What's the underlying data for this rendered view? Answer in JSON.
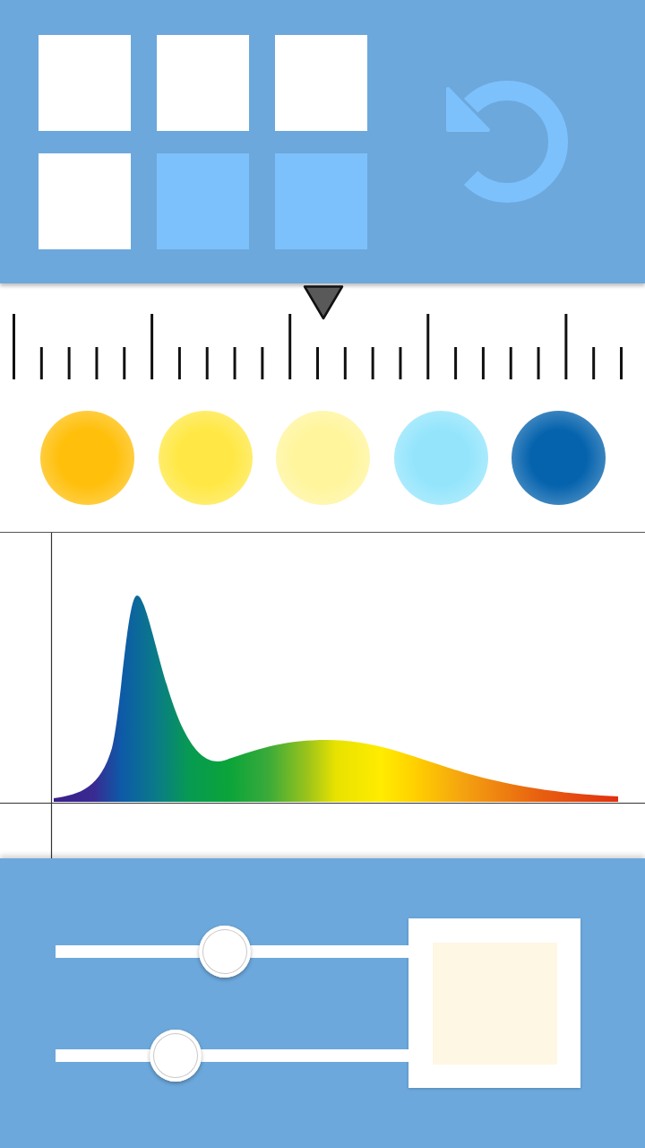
{
  "tiles": [
    {
      "on": true
    },
    {
      "on": true
    },
    {
      "on": true
    },
    {
      "on": true
    },
    {
      "on": false
    },
    {
      "on": false
    }
  ],
  "ruler": {
    "level": 0.51
  },
  "swatches": [
    {
      "color": "#ffbf0a"
    },
    {
      "color": "#ffe845"
    },
    {
      "color": "#fff59c"
    },
    {
      "color": "#94e5fc"
    },
    {
      "color": "#0563ad"
    }
  ],
  "sliders": [
    {
      "level": 0.48
    },
    {
      "level": 0.34
    }
  ],
  "preview": {
    "color": "#fef7e4"
  }
}
